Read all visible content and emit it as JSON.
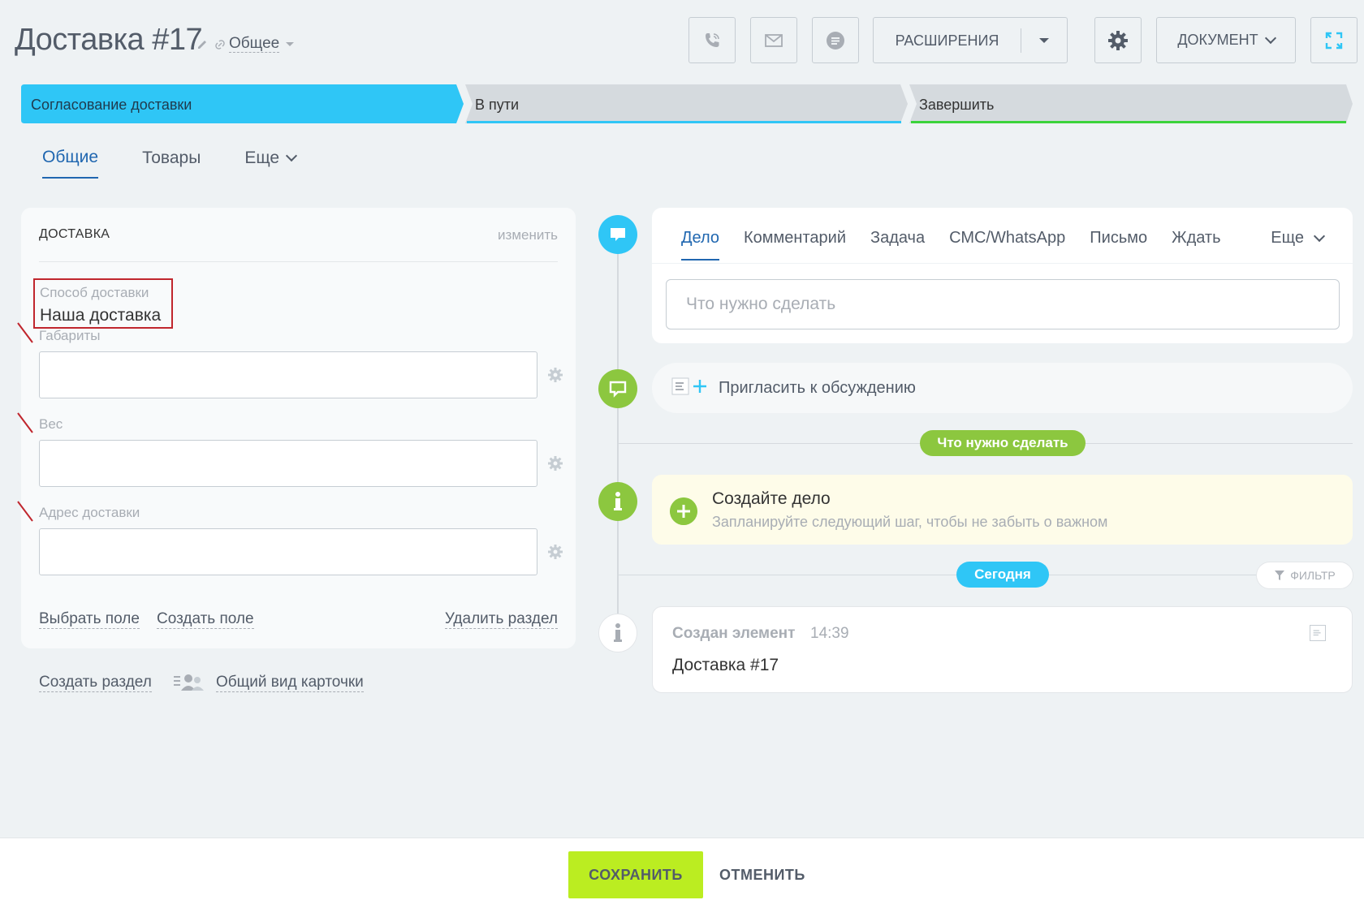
{
  "header": {
    "title": "Доставка #17",
    "category": "Общее",
    "extensions_label": "РАСШИРЕНИЯ",
    "document_label": "ДОКУМЕНТ"
  },
  "stages": [
    {
      "label": "Согласование доставки",
      "color": "#2fc6f6",
      "state": "active"
    },
    {
      "label": "В пути",
      "color": "#2fc6f6",
      "state": "pending"
    },
    {
      "label": "Завершить",
      "color": "#3bd33b",
      "state": "pending"
    }
  ],
  "tabs": [
    {
      "label": "Общие",
      "active": true
    },
    {
      "label": "Товары",
      "active": false
    },
    {
      "label": "Еще",
      "active": false
    }
  ],
  "section": {
    "title": "ДОСТАВКА",
    "change_link": "изменить",
    "delivery_method_label": "Способ доставки",
    "delivery_method_value": "Наша доставка",
    "fields": [
      {
        "label": "Габариты",
        "value": ""
      },
      {
        "label": "Вес",
        "value": ""
      },
      {
        "label": "Адрес доставки",
        "value": ""
      }
    ],
    "select_field": "Выбрать поле",
    "create_field": "Создать поле",
    "delete_section": "Удалить раздел"
  },
  "bottom_links": {
    "create_section": "Создать раздел",
    "common_view": "Общий вид карточки"
  },
  "activity": {
    "tabs": [
      "Дело",
      "Комментарий",
      "Задача",
      "СМС/WhatsApp",
      "Письмо",
      "Ждать"
    ],
    "more": "Еще",
    "input_placeholder": "Что нужно сделать",
    "invite": "Пригласить к обсуждению",
    "todo_pill": "Что нужно сделать",
    "create_title": "Создайте дело",
    "create_subtitle": "Запланируйте следующий шаг, чтобы не забыть о важном",
    "today_pill": "Сегодня",
    "filter": "ФИЛЬТР",
    "created_title": "Создан элемент",
    "created_time": "14:39",
    "created_value": "Доставка #17"
  },
  "footer": {
    "save": "СОХРАНИТЬ",
    "cancel": "ОТМЕНИТЬ"
  },
  "colors": {
    "accent_blue": "#2fc6f6",
    "accent_green": "#8cc73f",
    "save_green": "#bbed21",
    "highlight_red": "#c0262d"
  }
}
